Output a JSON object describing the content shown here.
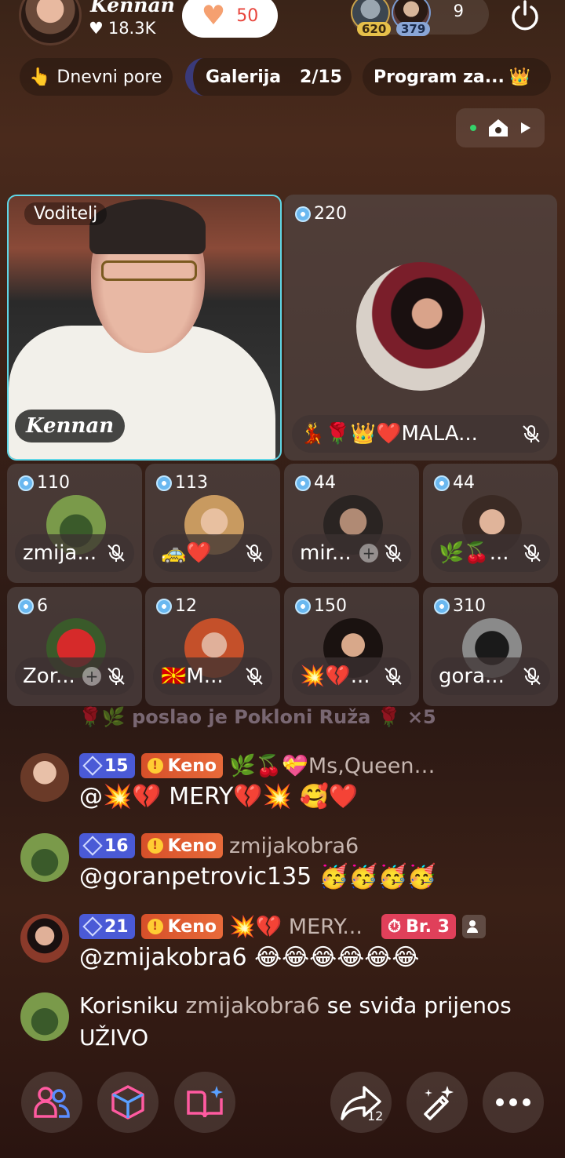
{
  "header": {
    "host_name": "Kennan",
    "host_likes": "18.3K",
    "heart_count": "50",
    "top_viewer_1_score": "620",
    "top_viewer_2_score": "379",
    "viewer_count": "9"
  },
  "pills": {
    "daily": "Dnevni pore",
    "gallery_label": "Galerija",
    "gallery_count": "2/15",
    "program": "Program za..."
  },
  "stage": {
    "host_role_label": "Voditelj",
    "host_name": "Kennan",
    "big_guest_score": "220",
    "big_guest_name": "💃🌹👑❤️MALA...",
    "guests": [
      {
        "score": "110",
        "name": "zmija..."
      },
      {
        "score": "113",
        "name": "🚕❤️"
      },
      {
        "score": "44",
        "name": "mir..."
      },
      {
        "score": "44",
        "name": "🌿🍒..."
      },
      {
        "score": "6",
        "name": "Zor..."
      },
      {
        "score": "12",
        "name": "🇲🇰M..."
      },
      {
        "score": "150",
        "name": "💥💔..."
      },
      {
        "score": "310",
        "name": "gora..."
      }
    ]
  },
  "chat": {
    "faded_line": "🌹🌿 poslao je Pokloni Ruža 🌹 ×5",
    "messages": [
      {
        "level": "15",
        "badge": "Keno",
        "user": "🌿🍒💝Ms,Queen💝...",
        "text": "@💥💔 MERY💔💥 🥰❤️"
      },
      {
        "level": "16",
        "badge": "Keno",
        "user": "zmijakobra6",
        "text": "@goranpetrovic135 🥳🥳🥳🥳"
      },
      {
        "level": "21",
        "badge": "Keno",
        "user": "💥💔 MERY...",
        "extra_badge": "Br. 3",
        "text": "@zmijakobra6 😂😂😂😂😂😂"
      }
    ],
    "system": {
      "prefix": "Korisniku",
      "user": "zmijakobra6",
      "suffix": "se sviđa prijenos UŽIVO"
    }
  },
  "bottom_bar": {
    "share_count": "12"
  }
}
